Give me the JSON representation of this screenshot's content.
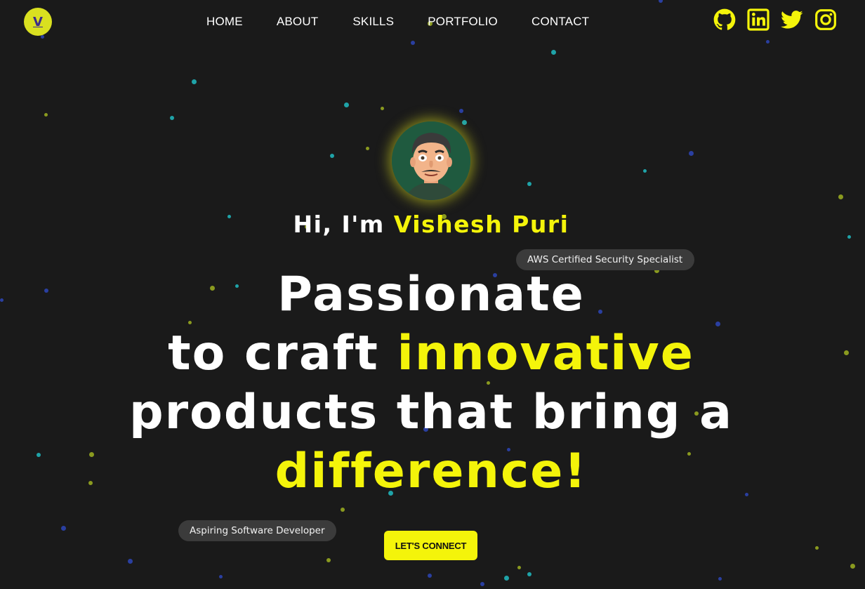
{
  "header": {
    "logo_letter": "V",
    "nav": {
      "home": "HOME",
      "about": "ABOUT",
      "skills": "SKILLS",
      "portfolio": "PORTFOLIO",
      "contact": "CONTACT"
    },
    "social_icons": [
      "github-icon",
      "linkedin-icon",
      "twitter-icon",
      "instagram-icon"
    ]
  },
  "hero": {
    "greeting_prefix": "Hi, I'm ",
    "name": "Vishesh Puri",
    "badge_top": "AWS Certified Security Specialist",
    "badge_bottom": "Aspiring Software Developer",
    "headline": {
      "line1": "Passionate",
      "line2_prefix": "to craft ",
      "line2_highlight": "innovative",
      "line3": "products that bring a",
      "line4_highlight": "difference!"
    },
    "cta_label": "LET'S CONNECT"
  },
  "colors": {
    "background": "#1a1a1a",
    "accent": "#f4f40a",
    "logo_bg": "#d9e020",
    "badge_bg": "#3b3b3b"
  }
}
